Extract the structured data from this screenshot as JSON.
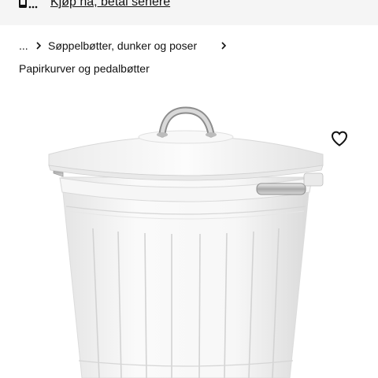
{
  "banner": {
    "link_text": "Kjøp nå, betal senere",
    "icon": "payment-phone-icon"
  },
  "breadcrumb": {
    "ellipsis": "...",
    "items": [
      "Søppelbøtter, dunker og poser"
    ],
    "current": "Papirkurver og pedalbøtter",
    "separator_icon": "chevron-right-icon"
  },
  "product": {
    "favorite_icon": "heart-icon",
    "image": "white-trash-can-with-lid"
  }
}
